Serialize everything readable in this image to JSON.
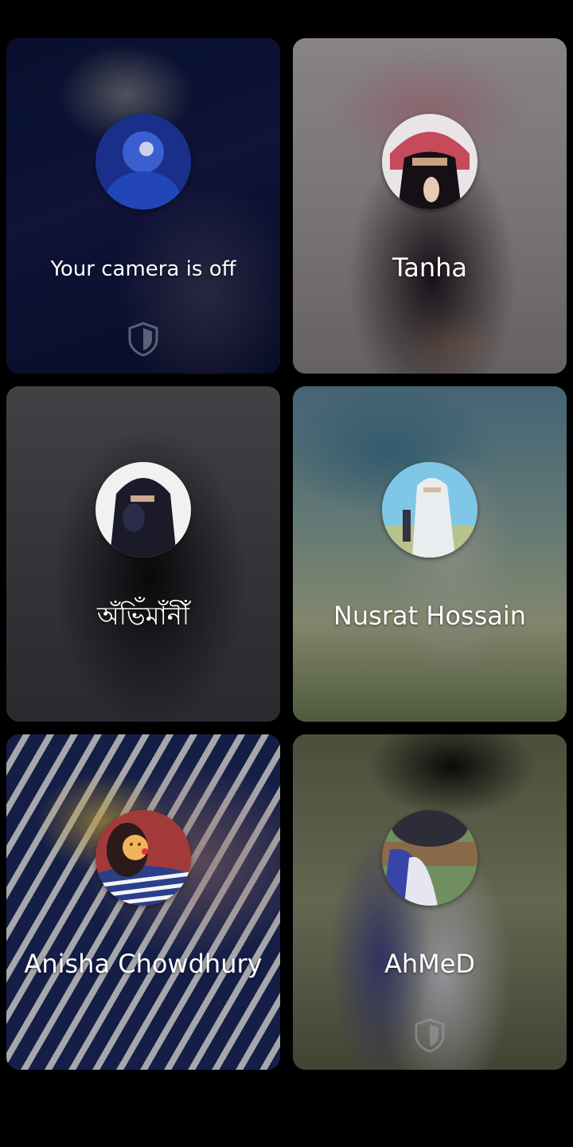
{
  "participants": [
    {
      "name": "Your camera is off",
      "small": true,
      "shield": true,
      "avatar_colors": [
        "#1a2f8a",
        "#3a5fd0",
        "#c8d2e8"
      ]
    },
    {
      "name": "Tanha",
      "small": false,
      "shield": false,
      "avatar_colors": [
        "#e9e4e6",
        "#c44a5c",
        "#151015"
      ]
    },
    {
      "name": "অঁভিঁমাঁনীঁ",
      "small": false,
      "shield": false,
      "avatar_colors": [
        "#f1f1f1",
        "#1a1a28",
        "#2b2b4a"
      ]
    },
    {
      "name": "Nusrat Hossain",
      "small": false,
      "shield": false,
      "avatar_colors": [
        "#7fc7e6",
        "#e8eef0",
        "#b7c38a"
      ]
    },
    {
      "name": "Anisha Chowdhury",
      "small": false,
      "shield": false,
      "avatar_colors": [
        "#f2b45a",
        "#2a3f8a",
        "#f4f4f6"
      ]
    },
    {
      "name": "AhMeD",
      "small": false,
      "shield": true,
      "avatar_colors": [
        "#2d2d3a",
        "#e6e6f0",
        "#6f8f60"
      ]
    }
  ]
}
